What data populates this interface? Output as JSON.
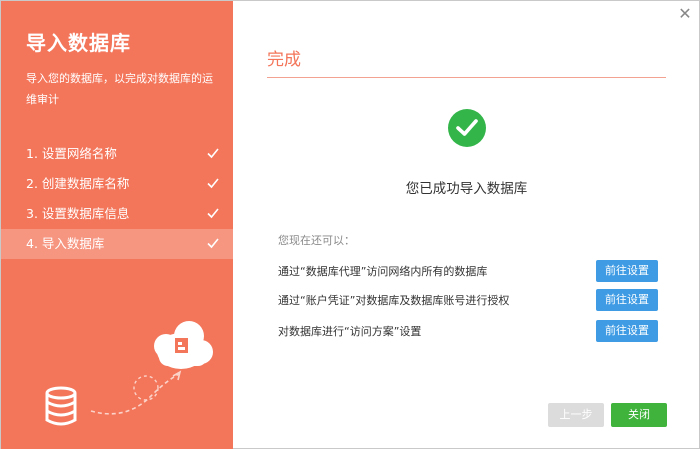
{
  "sidebar": {
    "title": "导入数据库",
    "description": "导入您的数据库，以完成对数据库的运维审计",
    "steps": [
      {
        "label": "1. 设置网络名称"
      },
      {
        "label": "2. 创建数据库名称"
      },
      {
        "label": "3. 设置数据库信息"
      },
      {
        "label": "4. 导入数据库"
      }
    ],
    "active_step": 4
  },
  "main": {
    "title": "完成",
    "success_message": "您已成功导入数据库",
    "more_label": "您现在还可以：",
    "options": [
      {
        "text": "通过“数据库代理”访问网络内所有的数据库",
        "button": "前往设置"
      },
      {
        "text": "通过“账户凭证”对数据库及数据库账号进行授权",
        "button": "前往设置"
      },
      {
        "text": "对数据库进行“访问方案”设置",
        "button": "前往设置"
      }
    ]
  },
  "footer": {
    "prev_label": "上一步",
    "close_label": "关闭"
  },
  "colors": {
    "accent": "#f3755a",
    "active_step_bg": "#f69580",
    "success": "#33b54a",
    "primary_button": "#3e9be4",
    "close_button": "#3fb33c",
    "disabled_button": "#dcdcdc"
  }
}
